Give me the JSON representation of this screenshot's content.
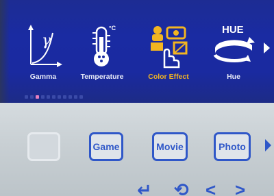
{
  "top_menu": {
    "items": [
      {
        "label": "Gamma",
        "icon": "gamma-icon",
        "active": false
      },
      {
        "label": "Temperature",
        "icon": "thermometer-icon",
        "active": false
      },
      {
        "label": "Color Effect",
        "icon": "color-effect-icon",
        "active": true
      },
      {
        "label": "Hue",
        "icon": "hue-icon",
        "active": false
      }
    ],
    "temperature_unit": "°C",
    "hue_caption": "HUE",
    "gamma_symbol": "γ",
    "next_icon": "chevron-right-icon"
  },
  "modes": {
    "items": [
      {
        "label": "",
        "disabled": true
      },
      {
        "label": "Game",
        "disabled": false
      },
      {
        "label": "Movie",
        "disabled": false
      },
      {
        "label": "Photo",
        "disabled": false
      }
    ],
    "next_icon": "chevron-right-icon"
  },
  "nav": {
    "enter": "↵",
    "back": "⟲",
    "left": "<",
    "right": ">"
  },
  "colors": {
    "menu_background": "#1a2ba2",
    "active_label": "#f0b323",
    "button_blue": "#2f57c8",
    "lower_background": "#c8cfd3"
  }
}
